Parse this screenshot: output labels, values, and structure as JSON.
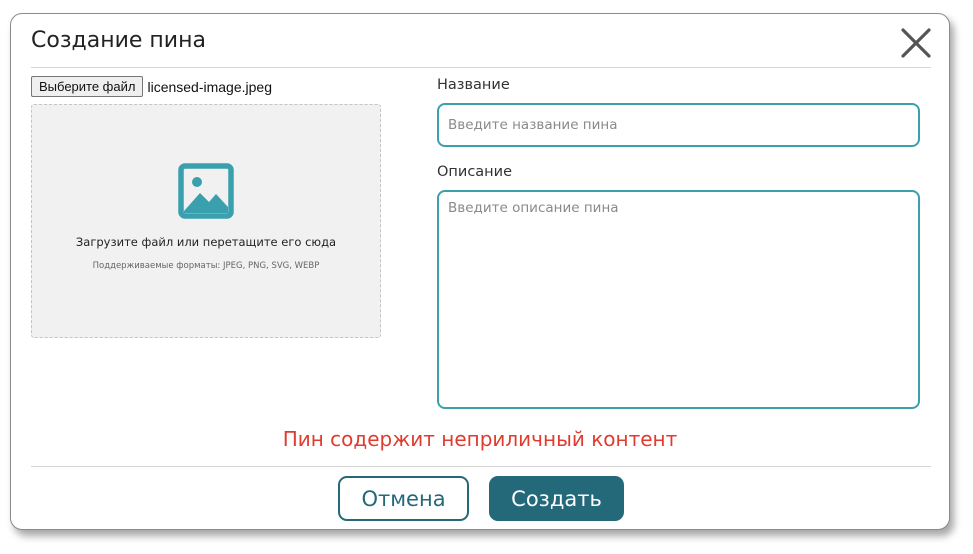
{
  "modal": {
    "title": "Создание пина",
    "close_label": "close"
  },
  "file_input": {
    "button_label": "Выберите файл",
    "file_name": "licensed-image.jpeg"
  },
  "dropzone": {
    "icon": "image-icon",
    "main_text": "Загрузите файл или перетащите его сюда",
    "formats_text": "Поддерживаемые форматы: JPEG, PNG, SVG, WEBP"
  },
  "form": {
    "name_label": "Название",
    "name_placeholder": "Введите название пина",
    "name_value": "",
    "description_label": "Описание",
    "description_placeholder": "Введите описание пина",
    "description_value": ""
  },
  "error_message": "Пин содержит неприличный контент",
  "actions": {
    "cancel_label": "Отмена",
    "create_label": "Создать"
  },
  "colors": {
    "accent": "#23697a",
    "field_border": "#3aa0ad",
    "error": "#e03b2f",
    "dropzone_bg": "#f1f1f1"
  }
}
